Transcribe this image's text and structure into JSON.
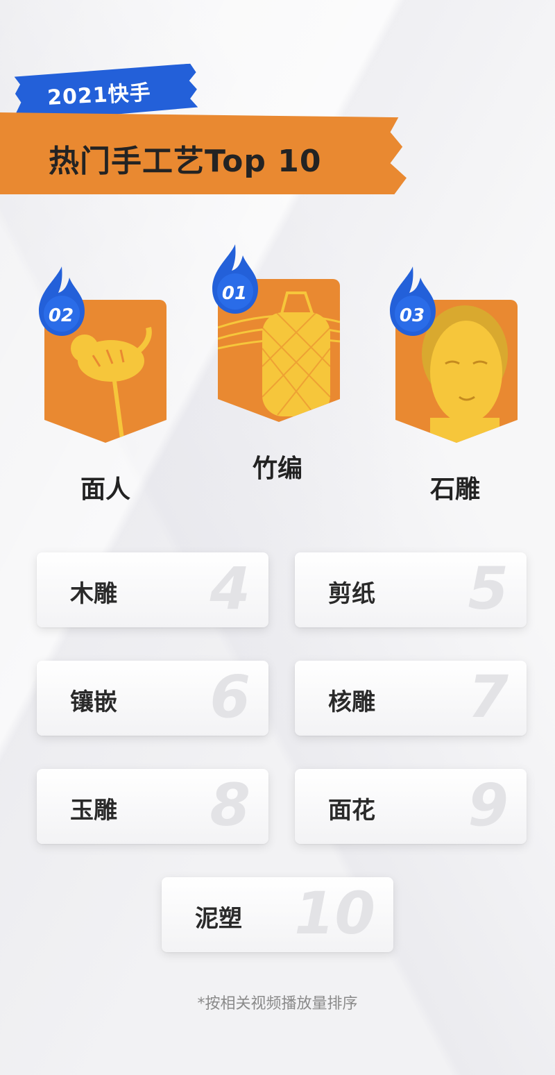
{
  "header": {
    "year_label": "2021快手",
    "title": "热门手工艺Top 10"
  },
  "podium": [
    {
      "rank": "02",
      "name": "面人"
    },
    {
      "rank": "01",
      "name": "竹编"
    },
    {
      "rank": "03",
      "name": "石雕"
    }
  ],
  "grid": [
    {
      "name": "木雕",
      "rank": "4"
    },
    {
      "name": "剪纸",
      "rank": "5"
    },
    {
      "name": "镶嵌",
      "rank": "6"
    },
    {
      "name": "核雕",
      "rank": "7"
    },
    {
      "name": "玉雕",
      "rank": "8"
    },
    {
      "name": "面花",
      "rank": "9"
    },
    {
      "name": "泥塑",
      "rank": "10"
    }
  ],
  "footnote": "*按相关视频播放量排序",
  "colors": {
    "orange": "#e98931",
    "blue": "#2360d9",
    "gold": "#f6c63b"
  }
}
